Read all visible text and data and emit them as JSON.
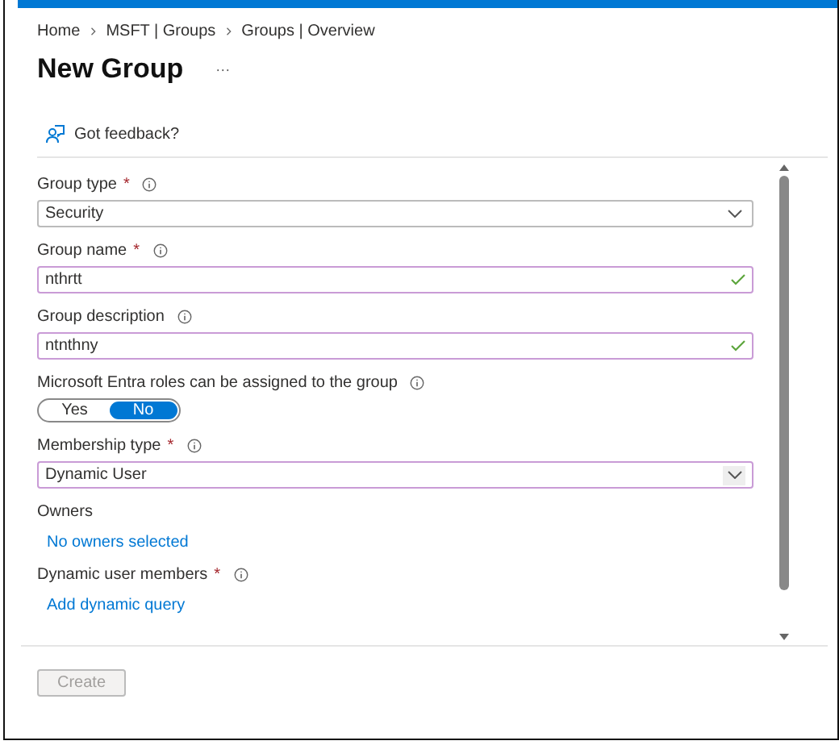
{
  "breadcrumb": [
    "Home",
    "MSFT | Groups",
    "Groups | Overview"
  ],
  "title": "New Group",
  "more": "···",
  "feedback": "Got feedback?",
  "fields": [
    {
      "kind": "dropdown",
      "label": "Group type",
      "required_mark": "*",
      "info": true,
      "value": "Security",
      "highlighted": false,
      "valid": false
    },
    {
      "kind": "text",
      "label": "Group name",
      "required_mark": "*",
      "info": true,
      "value": "nthrtt",
      "highlighted": true,
      "valid": true
    },
    {
      "kind": "text",
      "label": "Group description",
      "info": true,
      "value": "ntnthny",
      "highlighted": true,
      "valid": true
    },
    {
      "kind": "toggle",
      "label": "Microsoft Entra roles can be assigned to the group",
      "info": true,
      "options": [
        {
          "label": "Yes",
          "selected": false
        },
        {
          "label": "No",
          "selected": true
        }
      ]
    },
    {
      "kind": "dropdown",
      "label": "Membership type",
      "required_mark": "*",
      "info": true,
      "value": "Dynamic User",
      "highlighted": true,
      "valid": false
    },
    {
      "kind": "link",
      "label": "Owners",
      "info": false,
      "value": "No owners selected"
    },
    {
      "kind": "link",
      "label": "Dynamic user members",
      "required_mark": "*",
      "info": true,
      "value": "Add dynamic query"
    }
  ],
  "create": {
    "label": "Create",
    "disabled": true
  }
}
